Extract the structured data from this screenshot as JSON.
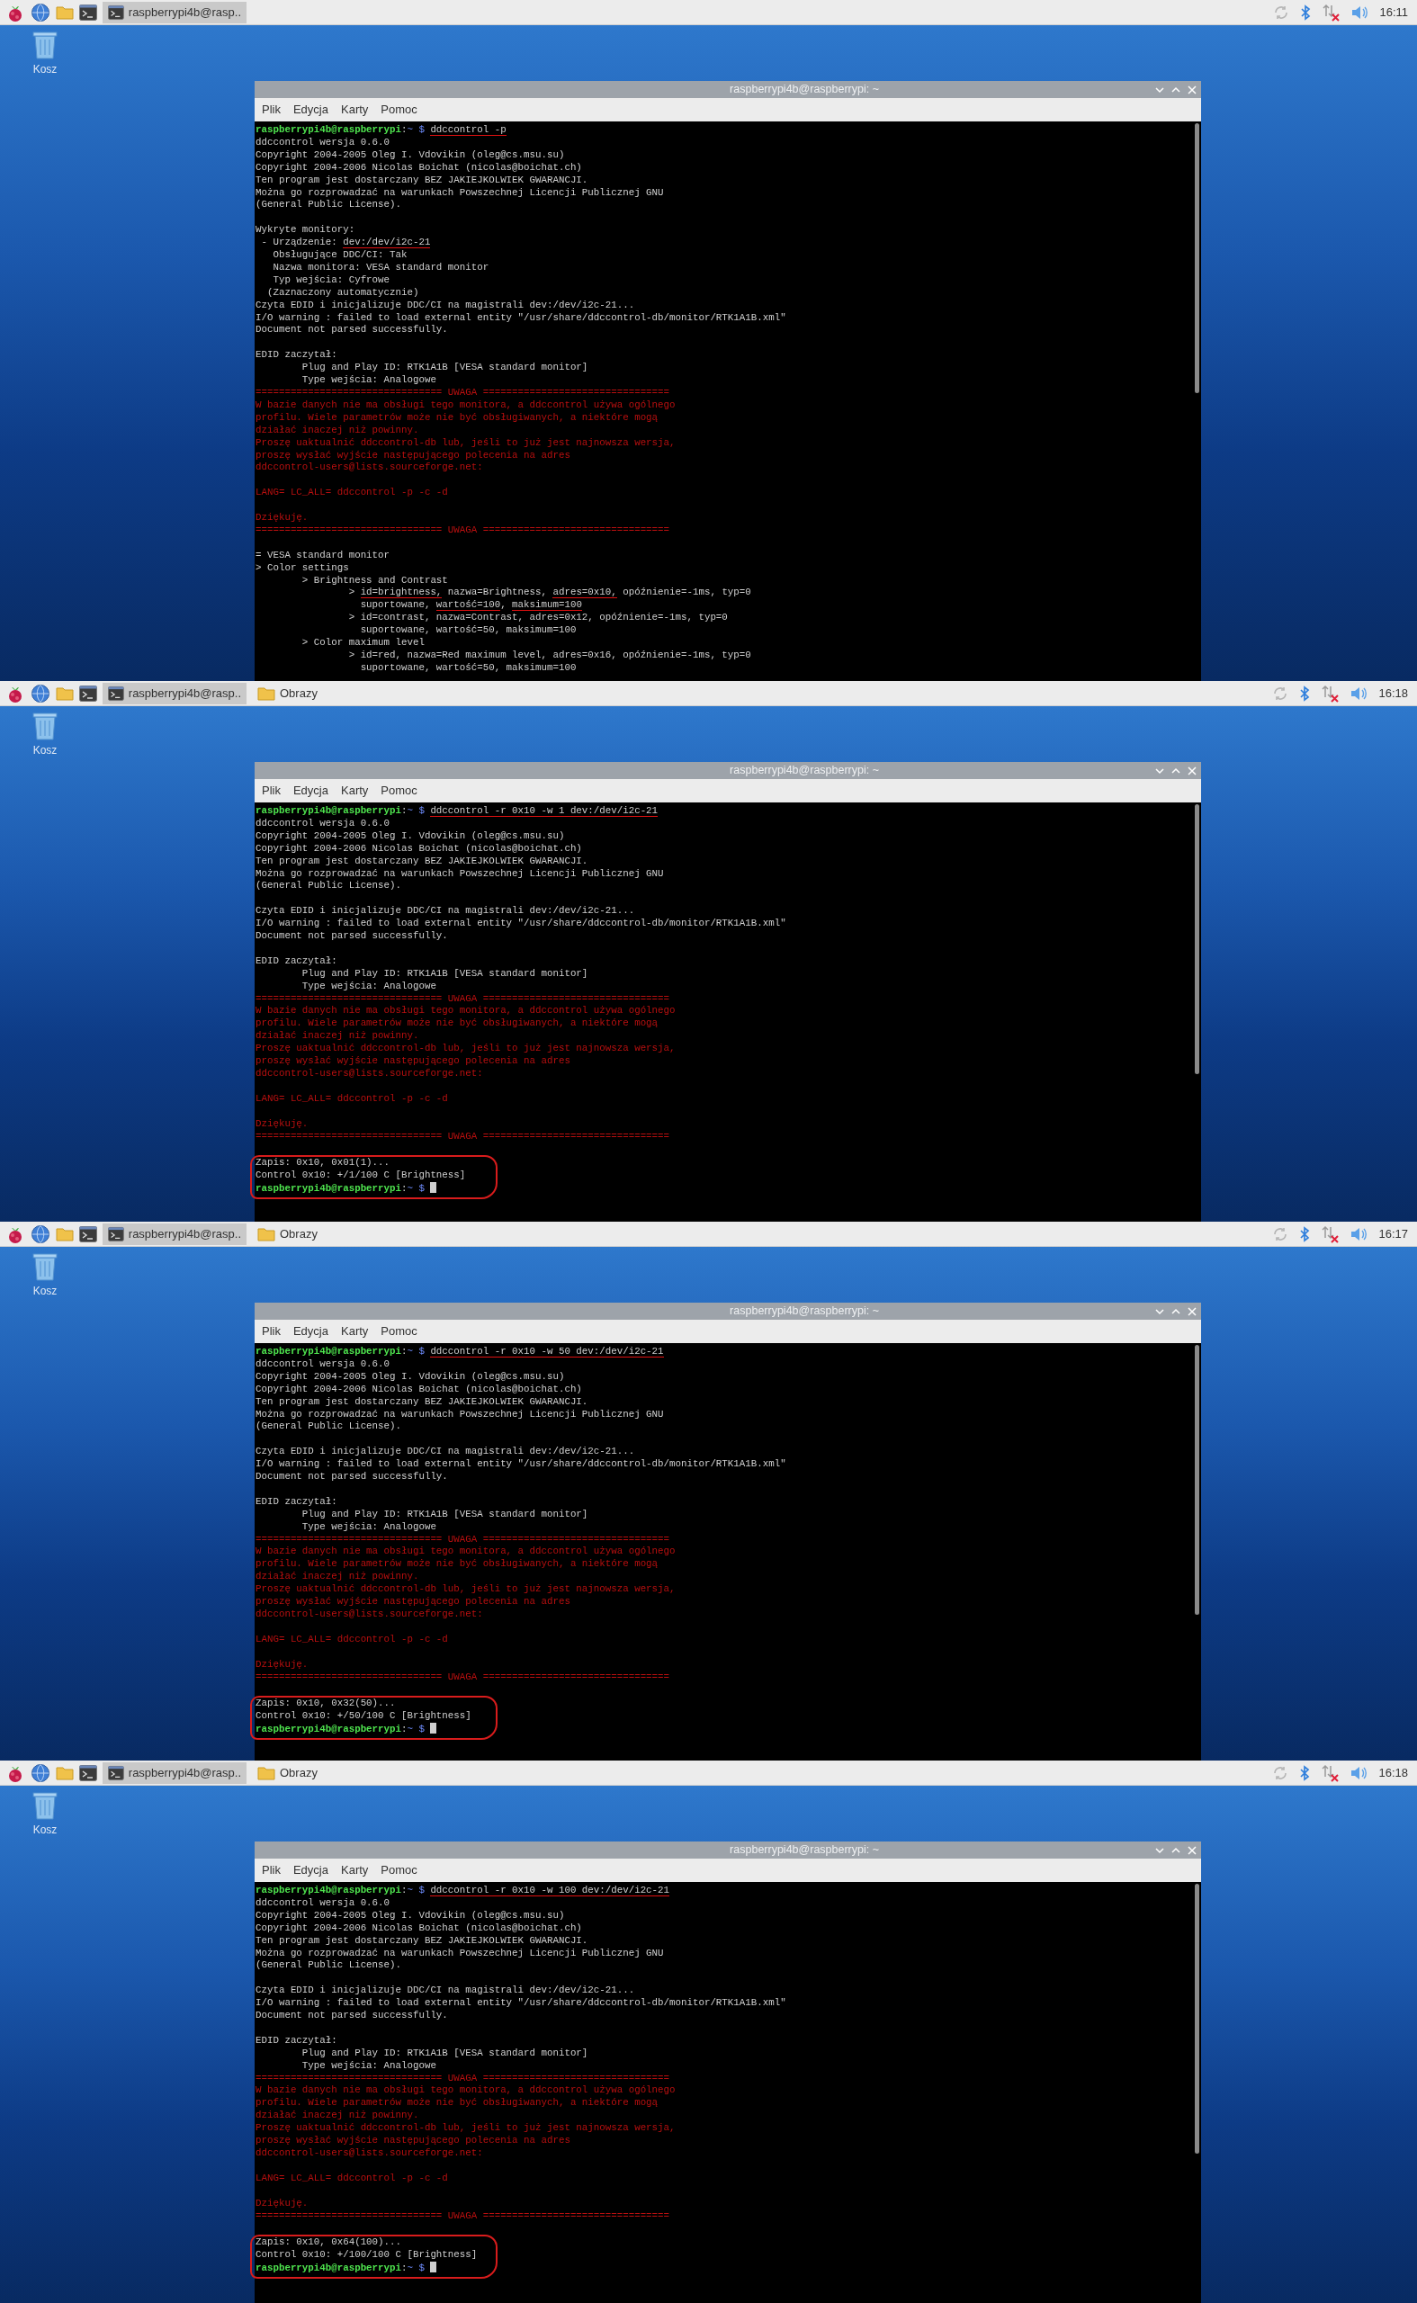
{
  "screens": [
    {
      "taskbar": {
        "tasks": [
          {
            "kind": "terminal",
            "label": "raspberrypi4b@rasp..",
            "selected": true
          }
        ],
        "time": "16:11"
      },
      "desktop_icon": {
        "label": "Kosz"
      },
      "window": {
        "title": "raspberrypi4b@raspberrypi: ~",
        "menu": [
          "Plik",
          "Edycja",
          "Karty",
          "Pomoc"
        ],
        "blocks": [
          {
            "circled": false,
            "lines": [
              {
                "kind": "prompt",
                "user": "raspberrypi4b@raspberrypi",
                "separator": ":",
                "path": "~",
                "symbol": "$",
                "command": "ddccontrol -p",
                "underlined": true
              },
              {
                "kind": "text",
                "text": "ddccontrol wersja 0.6.0"
              },
              {
                "kind": "text",
                "text": "Copyright 2004-2005 Oleg I. Vdovikin (oleg@cs.msu.su)"
              },
              {
                "kind": "text",
                "text": "Copyright 2004-2006 Nicolas Boichat (nicolas@boichat.ch)"
              },
              {
                "kind": "text",
                "text": "Ten program jest dostarczany BEZ JAKIEJKOLWIEK GWARANCJI."
              },
              {
                "kind": "text",
                "text": "Można go rozprowadzać na warunkach Powszechnej Licencji Publicznej GNU"
              },
              {
                "kind": "text",
                "text": "(General Public License)."
              }
            ]
          },
          {
            "circled": false,
            "lines": [
              {
                "kind": "text",
                "text": "Wykryte monitory:"
              },
              {
                "kind": "parts",
                "parts": [
                  {
                    "text": " - Urządzenie: ",
                    "underlined": false
                  },
                  {
                    "text": "dev:/dev/i2c-21",
                    "underlined": true
                  }
                ]
              },
              {
                "kind": "text",
                "text": "   Obsługujące DDC/CI: Tak"
              },
              {
                "kind": "text",
                "text": "   Nazwa monitora: VESA standard monitor"
              },
              {
                "kind": "text",
                "text": "   Typ wejścia: Cyfrowe"
              },
              {
                "kind": "text",
                "text": "  (Zaznaczony automatycznie)"
              },
              {
                "kind": "text",
                "text": "Czyta EDID i inicjalizuje DDC/CI na magistrali dev:/dev/i2c-21..."
              },
              {
                "kind": "text",
                "text": "I/O warning : failed to load external entity \"/usr/share/ddccontrol-db/monitor/RTK1A1B.xml\""
              },
              {
                "kind": "text",
                "text": "Document not parsed successfully."
              }
            ]
          },
          {
            "circled": false,
            "lines": [
              {
                "kind": "text",
                "text": "EDID zaczytał:"
              },
              {
                "kind": "text",
                "text": "        Plug and Play ID: RTK1A1B [VESA standard monitor]"
              },
              {
                "kind": "text",
                "text": "        Type wejścia: Analogowe"
              },
              {
                "kind": "warning",
                "text": "================================ UWAGA ================================"
              },
              {
                "kind": "warning",
                "text": "W bazie danych nie ma obsługi tego monitora, a ddccontrol używa ogólnego"
              },
              {
                "kind": "warning",
                "text": "profilu. Wiele parametrów może nie być obsługiwanych, a niektóre mogą"
              },
              {
                "kind": "warning",
                "text": "działać inaczej niż powinny."
              },
              {
                "kind": "warning",
                "text": "Proszę uaktualnić ddccontrol-db lub, jeśli to już jest najnowsza wersja,"
              },
              {
                "kind": "warning",
                "text": "proszę wysłać wyjście następującego polecenia na adres"
              },
              {
                "kind": "warning",
                "text": "ddccontrol-users@lists.sourceforge.net:"
              }
            ]
          },
          {
            "circled": false,
            "lines": [
              {
                "kind": "warning",
                "text": "LANG= LC_ALL= ddccontrol -p -c -d"
              }
            ]
          },
          {
            "circled": false,
            "lines": [
              {
                "kind": "warning",
                "text": "Dziękuję."
              },
              {
                "kind": "warning",
                "text": "================================ UWAGA ================================"
              }
            ]
          },
          {
            "circled": false,
            "lines": [
              {
                "kind": "text",
                "text": "= VESA standard monitor"
              },
              {
                "kind": "text",
                "text": "> Color settings"
              },
              {
                "kind": "text",
                "text": "        > Brightness and Contrast"
              },
              {
                "kind": "parts",
                "parts": [
                  {
                    "text": "                > ",
                    "underlined": false
                  },
                  {
                    "text": "id=brightness,",
                    "underlined": true
                  },
                  {
                    "text": " nazwa=Brightness, ",
                    "underlined": false
                  },
                  {
                    "text": "adres=0x10,",
                    "underlined": true
                  },
                  {
                    "text": " opóźnienie=-1ms, typ=0",
                    "underlined": false
                  }
                ]
              },
              {
                "kind": "parts",
                "parts": [
                  {
                    "text": "                  suportowane, ",
                    "underlined": false
                  },
                  {
                    "text": "wartość=100",
                    "underlined": true
                  },
                  {
                    "text": ", ",
                    "underlined": false
                  },
                  {
                    "text": "maksimum=100",
                    "underlined": true
                  }
                ]
              },
              {
                "kind": "text",
                "text": "                > id=contrast, nazwa=Contrast, adres=0x12, opóźnienie=-1ms, typ=0"
              },
              {
                "kind": "text",
                "text": "                  suportowane, wartość=50, maksimum=100"
              },
              {
                "kind": "text",
                "text": "        > Color maximum level"
              },
              {
                "kind": "text",
                "text": "                > id=red, nazwa=Red maximum level, adres=0x16, opóźnienie=-1ms, typ=0"
              },
              {
                "kind": "text",
                "text": "                  suportowane, wartość=50, maksimum=100"
              }
            ]
          }
        ]
      }
    },
    {
      "taskbar": {
        "tasks": [
          {
            "kind": "terminal",
            "label": "raspberrypi4b@rasp..",
            "selected": true
          },
          {
            "kind": "folder",
            "label": "Obrazy",
            "selected": false
          }
        ],
        "time": "16:18"
      },
      "desktop_icon": {
        "label": "Kosz"
      },
      "window": {
        "title": "raspberrypi4b@raspberrypi: ~",
        "menu": [
          "Plik",
          "Edycja",
          "Karty",
          "Pomoc"
        ],
        "blocks": [
          {
            "circled": false,
            "lines": [
              {
                "kind": "prompt",
                "user": "raspberrypi4b@raspberrypi",
                "separator": ":",
                "path": "~",
                "symbol": "$",
                "command": "ddccontrol -r 0x10 -w 1 dev:/dev/i2c-21",
                "underlined": true
              },
              {
                "kind": "text",
                "text": "ddccontrol wersja 0.6.0"
              },
              {
                "kind": "text",
                "text": "Copyright 2004-2005 Oleg I. Vdovikin (oleg@cs.msu.su)"
              },
              {
                "kind": "text",
                "text": "Copyright 2004-2006 Nicolas Boichat (nicolas@boichat.ch)"
              },
              {
                "kind": "text",
                "text": "Ten program jest dostarczany BEZ JAKIEJKOLWIEK GWARANCJI."
              },
              {
                "kind": "text",
                "text": "Można go rozprowadzać na warunkach Powszechnej Licencji Publicznej GNU"
              },
              {
                "kind": "text",
                "text": "(General Public License)."
              }
            ]
          },
          {
            "circled": false,
            "lines": [
              {
                "kind": "text",
                "text": "Czyta EDID i inicjalizuje DDC/CI na magistrali dev:/dev/i2c-21..."
              },
              {
                "kind": "text",
                "text": "I/O warning : failed to load external entity \"/usr/share/ddccontrol-db/monitor/RTK1A1B.xml\""
              },
              {
                "kind": "text",
                "text": "Document not parsed successfully."
              }
            ]
          },
          {
            "circled": false,
            "lines": [
              {
                "kind": "text",
                "text": "EDID zaczytał:"
              },
              {
                "kind": "text",
                "text": "        Plug and Play ID: RTK1A1B [VESA standard monitor]"
              },
              {
                "kind": "text",
                "text": "        Type wejścia: Analogowe"
              },
              {
                "kind": "warning",
                "text": "================================ UWAGA ================================"
              },
              {
                "kind": "warning",
                "text": "W bazie danych nie ma obsługi tego monitora, a ddccontrol używa ogólnego"
              },
              {
                "kind": "warning",
                "text": "profilu. Wiele parametrów może nie być obsługiwanych, a niektóre mogą"
              },
              {
                "kind": "warning",
                "text": "działać inaczej niż powinny."
              },
              {
                "kind": "warning",
                "text": "Proszę uaktualnić ddccontrol-db lub, jeśli to już jest najnowsza wersja,"
              },
              {
                "kind": "warning",
                "text": "proszę wysłać wyjście następującego polecenia na adres"
              },
              {
                "kind": "warning",
                "text": "ddccontrol-users@lists.sourceforge.net:"
              }
            ]
          },
          {
            "circled": false,
            "lines": [
              {
                "kind": "warning",
                "text": "LANG= LC_ALL= ddccontrol -p -c -d"
              }
            ]
          },
          {
            "circled": false,
            "lines": [
              {
                "kind": "warning",
                "text": "Dziękuję."
              },
              {
                "kind": "warning",
                "text": "================================ UWAGA ================================"
              }
            ]
          },
          {
            "circled": true,
            "lines": [
              {
                "kind": "text",
                "text": "Zapis: 0x10, 0x01(1)..."
              },
              {
                "kind": "text",
                "text": "Control 0x10: +/1/100 C [Brightness]"
              },
              {
                "kind": "prompt",
                "user": "raspberrypi4b@raspberrypi",
                "separator": ":",
                "path": "~",
                "symbol": "$",
                "cursor": true
              }
            ]
          }
        ]
      }
    },
    {
      "taskbar": {
        "tasks": [
          {
            "kind": "terminal",
            "label": "raspberrypi4b@rasp..",
            "selected": true
          },
          {
            "kind": "folder",
            "label": "Obrazy",
            "selected": false
          }
        ],
        "time": "16:17"
      },
      "desktop_icon": {
        "label": "Kosz"
      },
      "window": {
        "title": "raspberrypi4b@raspberrypi: ~",
        "menu": [
          "Plik",
          "Edycja",
          "Karty",
          "Pomoc"
        ],
        "blocks": [
          {
            "circled": false,
            "lines": [
              {
                "kind": "prompt",
                "user": "raspberrypi4b@raspberrypi",
                "separator": ":",
                "path": "~",
                "symbol": "$",
                "command": "ddccontrol -r 0x10 -w 50 dev:/dev/i2c-21",
                "underlined": true
              },
              {
                "kind": "text",
                "text": "ddccontrol wersja 0.6.0"
              },
              {
                "kind": "text",
                "text": "Copyright 2004-2005 Oleg I. Vdovikin (oleg@cs.msu.su)"
              },
              {
                "kind": "text",
                "text": "Copyright 2004-2006 Nicolas Boichat (nicolas@boichat.ch)"
              },
              {
                "kind": "text",
                "text": "Ten program jest dostarczany BEZ JAKIEJKOLWIEK GWARANCJI."
              },
              {
                "kind": "text",
                "text": "Można go rozprowadzać na warunkach Powszechnej Licencji Publicznej GNU"
              },
              {
                "kind": "text",
                "text": "(General Public License)."
              }
            ]
          },
          {
            "circled": false,
            "lines": [
              {
                "kind": "text",
                "text": "Czyta EDID i inicjalizuje DDC/CI na magistrali dev:/dev/i2c-21..."
              },
              {
                "kind": "text",
                "text": "I/O warning : failed to load external entity \"/usr/share/ddccontrol-db/monitor/RTK1A1B.xml\""
              },
              {
                "kind": "text",
                "text": "Document not parsed successfully."
              }
            ]
          },
          {
            "circled": false,
            "lines": [
              {
                "kind": "text",
                "text": "EDID zaczytał:"
              },
              {
                "kind": "text",
                "text": "        Plug and Play ID: RTK1A1B [VESA standard monitor]"
              },
              {
                "kind": "text",
                "text": "        Type wejścia: Analogowe"
              },
              {
                "kind": "warning",
                "text": "================================ UWAGA ================================"
              },
              {
                "kind": "warning",
                "text": "W bazie danych nie ma obsługi tego monitora, a ddccontrol używa ogólnego"
              },
              {
                "kind": "warning",
                "text": "profilu. Wiele parametrów może nie być obsługiwanych, a niektóre mogą"
              },
              {
                "kind": "warning",
                "text": "działać inaczej niż powinny."
              },
              {
                "kind": "warning",
                "text": "Proszę uaktualnić ddccontrol-db lub, jeśli to już jest najnowsza wersja,"
              },
              {
                "kind": "warning",
                "text": "proszę wysłać wyjście następującego polecenia na adres"
              },
              {
                "kind": "warning",
                "text": "ddccontrol-users@lists.sourceforge.net:"
              }
            ]
          },
          {
            "circled": false,
            "lines": [
              {
                "kind": "warning",
                "text": "LANG= LC_ALL= ddccontrol -p -c -d"
              }
            ]
          },
          {
            "circled": false,
            "lines": [
              {
                "kind": "warning",
                "text": "Dziękuję."
              },
              {
                "kind": "warning",
                "text": "================================ UWAGA ================================"
              }
            ]
          },
          {
            "circled": true,
            "lines": [
              {
                "kind": "text",
                "text": "Zapis: 0x10, 0x32(50)..."
              },
              {
                "kind": "text",
                "text": "Control 0x10: +/50/100 C [Brightness]"
              },
              {
                "kind": "prompt",
                "user": "raspberrypi4b@raspberrypi",
                "separator": ":",
                "path": "~",
                "symbol": "$",
                "cursor": true
              }
            ]
          }
        ]
      }
    },
    {
      "taskbar": {
        "tasks": [
          {
            "kind": "terminal",
            "label": "raspberrypi4b@rasp..",
            "selected": true
          },
          {
            "kind": "folder",
            "label": "Obrazy",
            "selected": false
          }
        ],
        "time": "16:18"
      },
      "desktop_icon": {
        "label": "Kosz"
      },
      "window": {
        "title": "raspberrypi4b@raspberrypi: ~",
        "menu": [
          "Plik",
          "Edycja",
          "Karty",
          "Pomoc"
        ],
        "blocks": [
          {
            "circled": false,
            "lines": [
              {
                "kind": "prompt",
                "user": "raspberrypi4b@raspberrypi",
                "separator": ":",
                "path": "~",
                "symbol": "$",
                "command": "ddccontrol -r 0x10 -w 100 dev:/dev/i2c-21",
                "underlined": true
              },
              {
                "kind": "text",
                "text": "ddccontrol wersja 0.6.0"
              },
              {
                "kind": "text",
                "text": "Copyright 2004-2005 Oleg I. Vdovikin (oleg@cs.msu.su)"
              },
              {
                "kind": "text",
                "text": "Copyright 2004-2006 Nicolas Boichat (nicolas@boichat.ch)"
              },
              {
                "kind": "text",
                "text": "Ten program jest dostarczany BEZ JAKIEJKOLWIEK GWARANCJI."
              },
              {
                "kind": "text",
                "text": "Można go rozprowadzać na warunkach Powszechnej Licencji Publicznej GNU"
              },
              {
                "kind": "text",
                "text": "(General Public License)."
              }
            ]
          },
          {
            "circled": false,
            "lines": [
              {
                "kind": "text",
                "text": "Czyta EDID i inicjalizuje DDC/CI na magistrali dev:/dev/i2c-21..."
              },
              {
                "kind": "text",
                "text": "I/O warning : failed to load external entity \"/usr/share/ddccontrol-db/monitor/RTK1A1B.xml\""
              },
              {
                "kind": "text",
                "text": "Document not parsed successfully."
              }
            ]
          },
          {
            "circled": false,
            "lines": [
              {
                "kind": "text",
                "text": "EDID zaczytał:"
              },
              {
                "kind": "text",
                "text": "        Plug and Play ID: RTK1A1B [VESA standard monitor]"
              },
              {
                "kind": "text",
                "text": "        Type wejścia: Analogowe"
              },
              {
                "kind": "warning",
                "text": "================================ UWAGA ================================"
              },
              {
                "kind": "warning",
                "text": "W bazie danych nie ma obsługi tego monitora, a ddccontrol używa ogólnego"
              },
              {
                "kind": "warning",
                "text": "profilu. Wiele parametrów może nie być obsługiwanych, a niektóre mogą"
              },
              {
                "kind": "warning",
                "text": "działać inaczej niż powinny."
              },
              {
                "kind": "warning",
                "text": "Proszę uaktualnić ddccontrol-db lub, jeśli to już jest najnowsza wersja,"
              },
              {
                "kind": "warning",
                "text": "proszę wysłać wyjście następującego polecenia na adres"
              },
              {
                "kind": "warning",
                "text": "ddccontrol-users@lists.sourceforge.net:"
              }
            ]
          },
          {
            "circled": false,
            "lines": [
              {
                "kind": "warning",
                "text": "LANG= LC_ALL= ddccontrol -p -c -d"
              }
            ]
          },
          {
            "circled": false,
            "lines": [
              {
                "kind": "warning",
                "text": "Dziękuję."
              },
              {
                "kind": "warning",
                "text": "================================ UWAGA ================================"
              }
            ]
          },
          {
            "circled": true,
            "lines": [
              {
                "kind": "text",
                "text": "Zapis: 0x10, 0x64(100)..."
              },
              {
                "kind": "text",
                "text": "Control 0x10: +/100/100 C [Brightness]"
              },
              {
                "kind": "prompt",
                "user": "raspberrypi4b@raspberrypi",
                "separator": ":",
                "path": "~",
                "symbol": "$",
                "cursor": true
              }
            ]
          }
        ]
      }
    }
  ]
}
